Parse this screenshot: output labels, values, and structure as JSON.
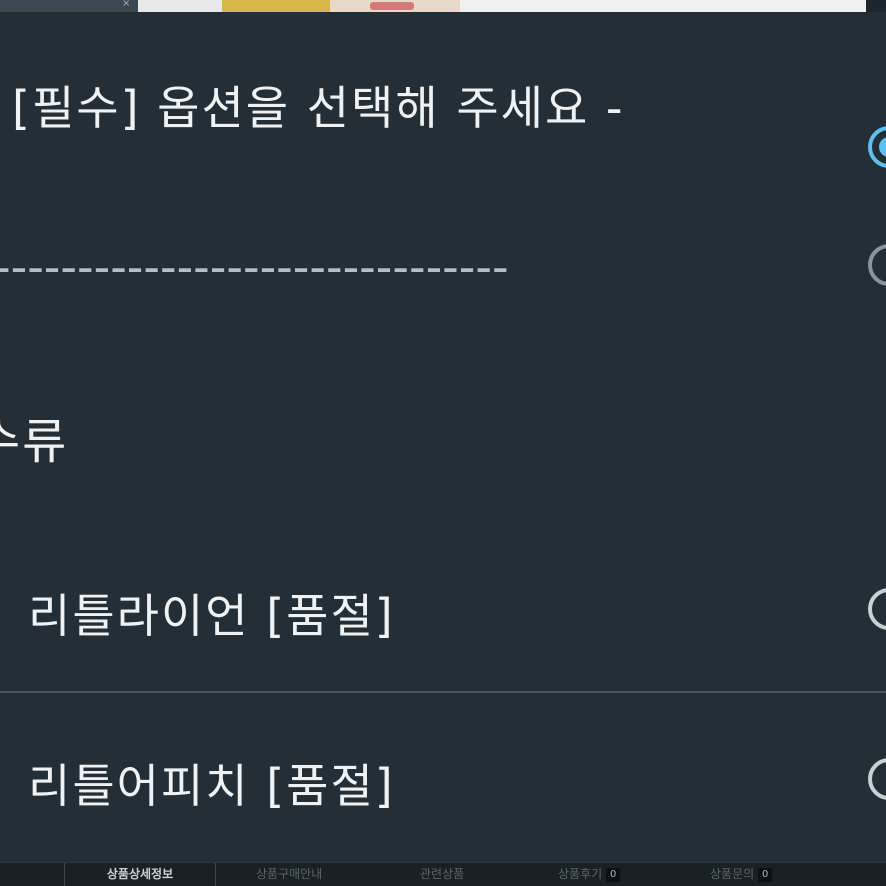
{
  "dialog": {
    "options": [
      {
        "id": "placeholder",
        "label": "[필수] 옵션을 선택해 주세요 -",
        "selected": true
      },
      {
        "id": "divider",
        "label": "-------------------------------",
        "selected": false,
        "disabled": true
      },
      {
        "id": "group",
        "label": "수류"
      },
      {
        "id": "little-lion",
        "label": "리틀라이언 [품절]",
        "selected": false
      },
      {
        "id": "little-peach",
        "label": "리틀어피치 [품절]",
        "selected": false
      }
    ],
    "colors": {
      "background": "#232e36",
      "text": "#eef2f4",
      "radio_selected": "#5cc0f0",
      "radio_border": "#c9d0d4"
    }
  },
  "tabbar": {
    "tabs": [
      {
        "label": "상품상세정보",
        "active": true
      },
      {
        "label": "상품구매안내",
        "active": false
      },
      {
        "label": "관련상품",
        "active": false
      },
      {
        "label": "상품후기",
        "active": false,
        "count": "0"
      },
      {
        "label": "상품문의",
        "active": false,
        "count": "0"
      }
    ]
  }
}
